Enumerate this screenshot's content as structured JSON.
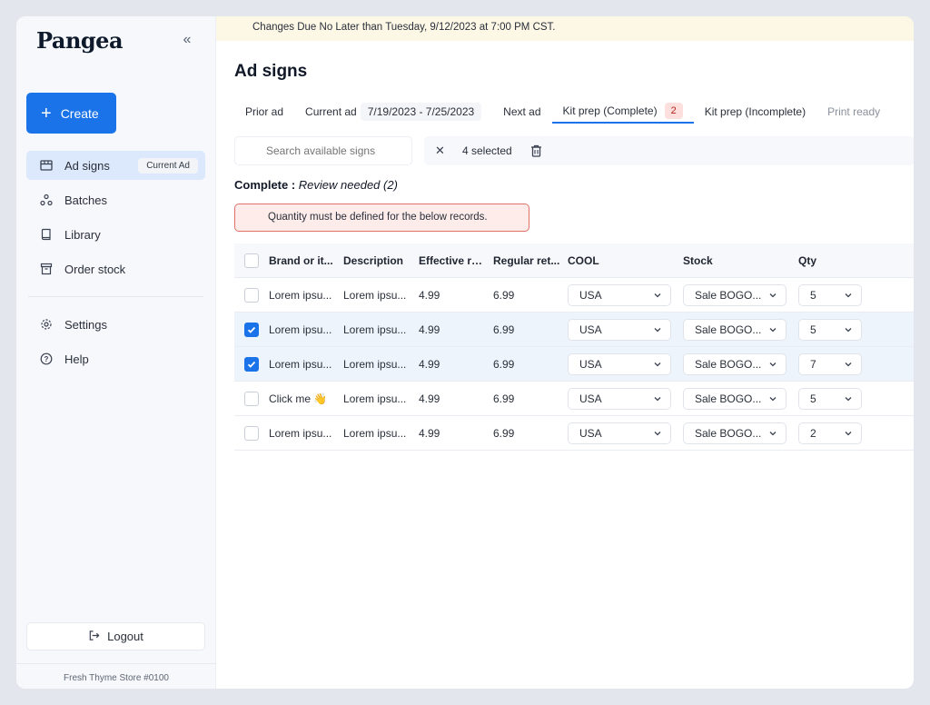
{
  "sidebar": {
    "logo": "Pangea",
    "create_label": "Create",
    "items": [
      {
        "label": "Ad signs",
        "badge": "Current Ad"
      },
      {
        "label": "Batches"
      },
      {
        "label": "Library"
      },
      {
        "label": "Order stock"
      },
      {
        "label": "Settings"
      },
      {
        "label": "Help"
      }
    ],
    "logout_label": "Logout",
    "store": "Fresh Thyme Store #0100"
  },
  "banner": "Changes Due No Later than Tuesday, 9/12/2023 at 7:00 PM CST.",
  "page_title": "Ad signs",
  "tabs": {
    "prior": "Prior ad",
    "current": "Current ad",
    "current_range": "7/19/2023 - 7/25/2023",
    "next": "Next ad",
    "kit_complete": "Kit prep (Complete)",
    "kit_complete_count": "2",
    "kit_incomplete": "Kit prep (Incomplete)",
    "print_ready": "Print ready"
  },
  "search": {
    "placeholder": "Search available signs"
  },
  "selection": {
    "count_label": "4 selected"
  },
  "section": {
    "status": "Complete :",
    "note": "Review needed (2)"
  },
  "alert": "Quantity must be defined for the below records.",
  "table": {
    "headers": {
      "brand": "Brand or it...",
      "description": "Description",
      "effective": "Effective re...",
      "regular": "Regular ret...",
      "cool": "COOL",
      "stock": "Stock",
      "qty": "Qty"
    },
    "rows": [
      {
        "brand": "Lorem ipsu...",
        "description": "Lorem ipsu...",
        "effective": "4.99",
        "regular": "6.99",
        "cool": "USA",
        "stock": "Sale BOGO...",
        "qty": "5",
        "checked": false
      },
      {
        "brand": "Lorem ipsu...",
        "description": "Lorem ipsu...",
        "effective": "4.99",
        "regular": "6.99",
        "cool": "USA",
        "stock": "Sale BOGO...",
        "qty": "5",
        "checked": true
      },
      {
        "brand": "Lorem ipsu...",
        "description": "Lorem ipsu...",
        "effective": "4.99",
        "regular": "6.99",
        "cool": "USA",
        "stock": "Sale BOGO...",
        "qty": "7",
        "checked": true
      },
      {
        "brand": "Click me 👋",
        "description": "Lorem ipsu...",
        "effective": "4.99",
        "regular": "6.99",
        "cool": "USA",
        "stock": "Sale BOGO...",
        "qty": "5",
        "checked": false
      },
      {
        "brand": "Lorem ipsu...",
        "description": "Lorem ipsu...",
        "effective": "4.99",
        "regular": "6.99",
        "cool": "USA",
        "stock": "Sale BOGO...",
        "qty": "2",
        "checked": false
      }
    ]
  },
  "colors": {
    "accent": "#1a73e8",
    "banner_bg": "#fdf8e6",
    "alert_border": "#e0716a",
    "alert_bg": "#fdecea"
  }
}
